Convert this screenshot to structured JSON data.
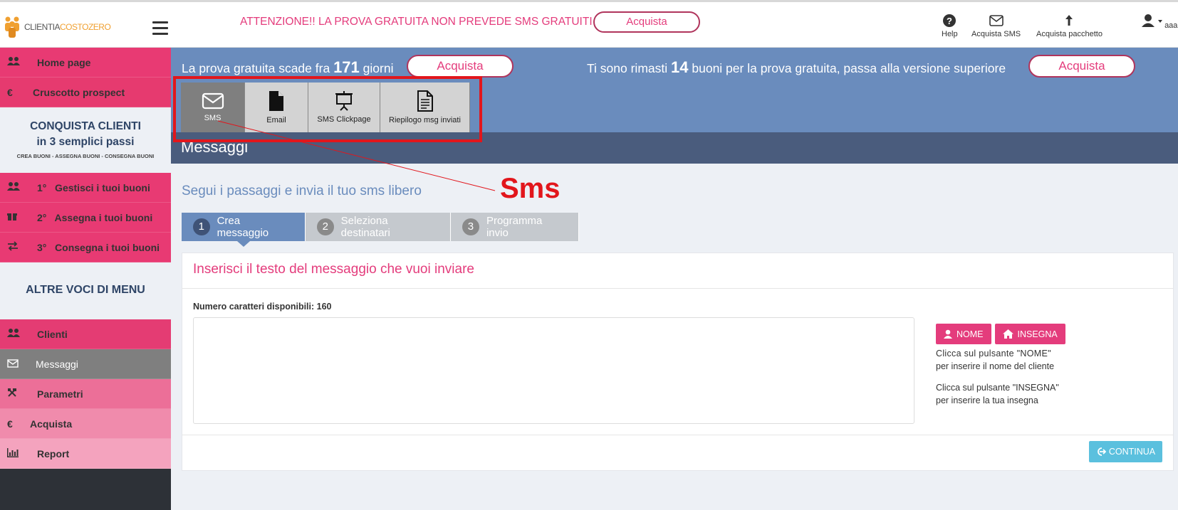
{
  "header": {
    "logo_text_a": "CLIENTIA",
    "logo_text_b": "COSTO",
    "logo_text_c": "ZERO",
    "alert": "ATTENZIONE!! LA PROVA GRATUITA NON PREVEDE SMS GRATUITI",
    "alert_button": "Acquista",
    "tools": [
      {
        "label": "Help",
        "icon": "help-icon"
      },
      {
        "label": "Acquista SMS",
        "icon": "envelope-icon"
      },
      {
        "label": "Acquista pacchetto",
        "icon": "arrow-up-icon"
      }
    ],
    "user_label": "aaa"
  },
  "sidebar": {
    "items_top": [
      {
        "label": "Home page",
        "icon": "users-icon",
        "color": "#e83a73"
      },
      {
        "label": "Cruscotto prospect",
        "icon": "euro-icon",
        "color": "#e63a6f"
      }
    ],
    "conquista": {
      "line1": "CONQUISTA CLIENTI",
      "line2": "in 3 semplici passi",
      "line3": "CREA BUONI - ASSEGNA BUONI - CONSEGNA BUONI"
    },
    "steps": [
      {
        "label": "1°   Gestisci i tuoi buoni",
        "icon": "users-icon"
      },
      {
        "label": "2°   Assegna i tuoi buoni",
        "icon": "gift-icon"
      },
      {
        "label": "3°   Consegna i tuoi buoni",
        "icon": "exchange-icon"
      }
    ],
    "altre": "ALTRE VOCI DI MENU",
    "items_bottom": [
      {
        "label": "Clienti",
        "icon": "users-icon",
        "color": "#e43c73"
      },
      {
        "label": "Messaggi",
        "icon": "envelope-icon",
        "color": "#7f7f7f"
      },
      {
        "label": "Parametri",
        "icon": "tools-icon",
        "color": "#ec6f98"
      },
      {
        "label": "Acquista",
        "icon": "euro-icon",
        "color": "#f08bac"
      },
      {
        "label": "Report",
        "icon": "bar-chart-icon",
        "color": "#f4a3be"
      }
    ]
  },
  "banner": {
    "trial_prefix": "La prova gratuita scade fra",
    "trial_days": "171",
    "trial_suffix": "giorni",
    "trial_button": "Acquista",
    "voucher_prefix": "Ti sono rimasti",
    "voucher_count": "14",
    "voucher_suffix": "buoni per la prova gratuita, passa alla versione superiore",
    "voucher_button": "Acquista"
  },
  "tabs": [
    {
      "label": "SMS",
      "icon": "envelope-icon",
      "active": true
    },
    {
      "label": "Email",
      "icon": "document-icon",
      "active": false
    },
    {
      "label": "SMS Clickpage",
      "icon": "presentation-icon",
      "active": false
    },
    {
      "label": "Riepilogo msg inviati",
      "icon": "list-document-icon",
      "active": false
    }
  ],
  "page_title": "Messaggi",
  "annotation": "Sms",
  "subtitle": "Segui i passaggi e invia il tuo sms libero",
  "steps": [
    {
      "num": "1",
      "label": "Crea messaggio",
      "active": true
    },
    {
      "num": "2",
      "label": "Seleziona destinatari",
      "active": false
    },
    {
      "num": "3",
      "label": "Programma invio",
      "active": false
    }
  ],
  "panel": {
    "title": "Inserisci il testo del messaggio che vuoi inviare",
    "char_count": "Numero caratteri disponibili: 160",
    "message_value": "",
    "nome_button": "NOME",
    "insegna_button": "INSEGNA",
    "hint_nome_1": "Clicca sul pulsante \"NOME\"",
    "hint_nome_2": "per inserire il nome del cliente",
    "hint_insegna_1": "Clicca sul pulsante \"INSEGNA\"",
    "hint_insegna_2": "per inserire la tua insegna",
    "continue_button": "CONTINUA"
  }
}
